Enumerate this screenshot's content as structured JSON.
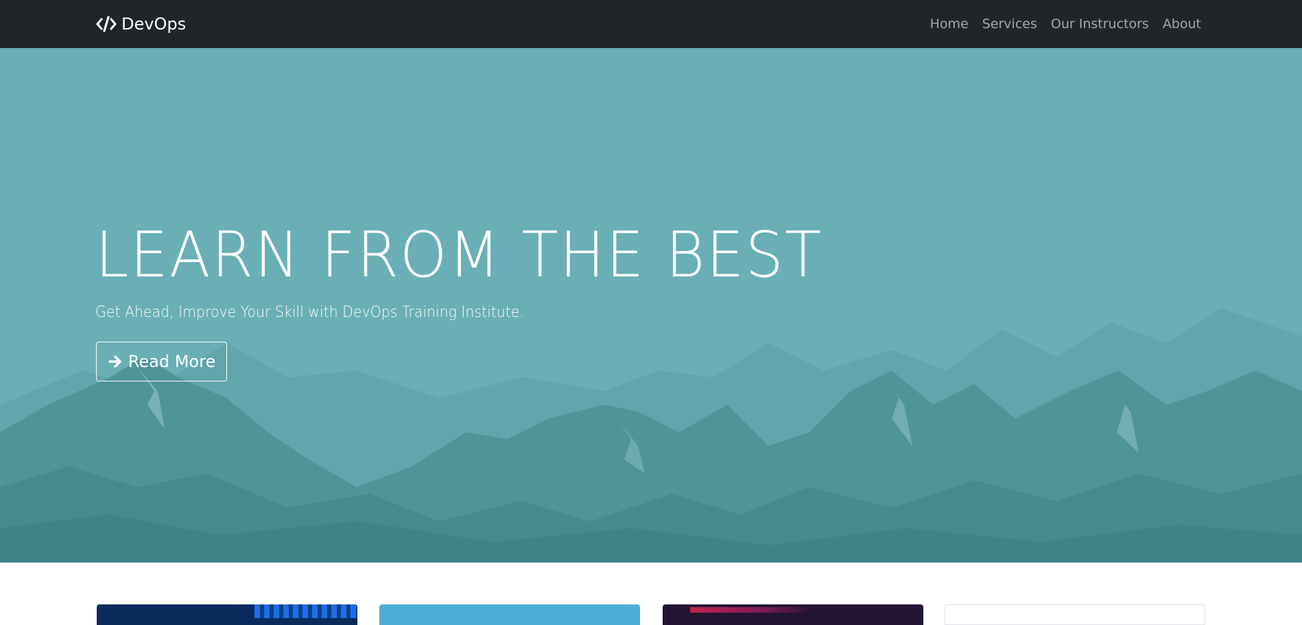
{
  "navbar": {
    "brand": "DevOps",
    "links": [
      "Home",
      "Services",
      "Our Instructors",
      "About"
    ]
  },
  "hero": {
    "title": "LEARN FROM THE BEST",
    "subtitle": "Get Ahead, Improve Your Skill with DevOps Training Institute.",
    "button_label": "Read More",
    "background_color": "#69afb5"
  },
  "icons": {
    "brand": "code-icon",
    "button": "arrow-right-icon"
  }
}
